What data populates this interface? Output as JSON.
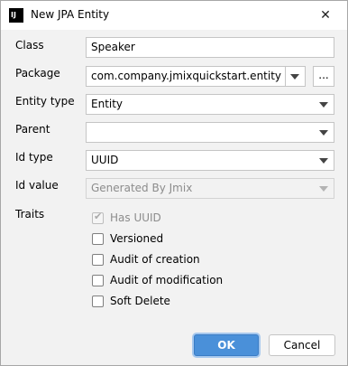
{
  "window": {
    "title": "New JPA Entity",
    "icon": "IJ",
    "close_glyph": "✕"
  },
  "form": {
    "class": {
      "label": "Class",
      "value": "Speaker"
    },
    "package": {
      "label": "Package",
      "value": "com.company.jmixquickstart.entity",
      "browse_label": "..."
    },
    "entity_type": {
      "label": "Entity type",
      "value": "Entity"
    },
    "parent": {
      "label": "Parent",
      "value": ""
    },
    "id_type": {
      "label": "Id type",
      "value": "UUID"
    },
    "id_value": {
      "label": "Id value",
      "value": "Generated By Jmix"
    },
    "traits": {
      "label": "Traits",
      "items": [
        {
          "label": "Has UUID",
          "checked": true,
          "disabled": true
        },
        {
          "label": "Versioned",
          "checked": false,
          "disabled": false
        },
        {
          "label": "Audit of creation",
          "checked": false,
          "disabled": false
        },
        {
          "label": "Audit of modification",
          "checked": false,
          "disabled": false
        },
        {
          "label": "Soft Delete",
          "checked": false,
          "disabled": false
        }
      ]
    }
  },
  "buttons": {
    "ok": "OK",
    "cancel": "Cancel"
  },
  "colors": {
    "accent": "#4a90d9",
    "background": "#f2f2f2"
  }
}
